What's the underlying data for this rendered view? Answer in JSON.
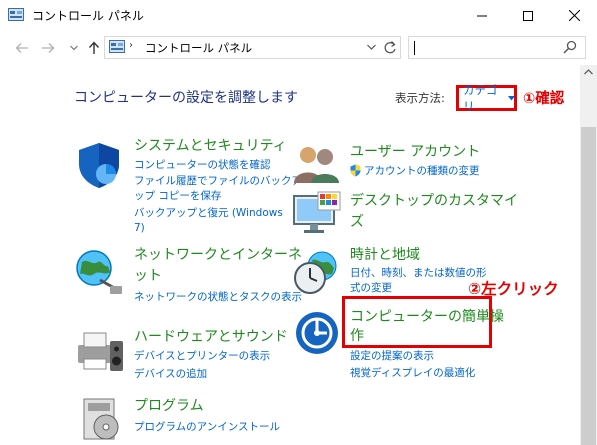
{
  "window": {
    "title": "コントロール パネル"
  },
  "address": {
    "separator": "›",
    "path": "コントロール パネル"
  },
  "content": {
    "heading": "コンピューターの設定を調整します",
    "view_by_label": "表示方法:",
    "view_by_value": "カテゴリ"
  },
  "annotations": {
    "step1": "①確認",
    "step2": "②左クリック"
  },
  "categories": {
    "system": {
      "title": "システムとセキュリティ",
      "links": [
        "コンピューターの状態を確認",
        "ファイル履歴でファイルのバックア",
        "ップ コピーを保存",
        "バックアップと復元 (Windows",
        "7)"
      ]
    },
    "network": {
      "title_line1": "ネットワークとインターネ",
      "title_line2": "ット",
      "links": [
        "ネットワークの状態とタスクの表示"
      ]
    },
    "hardware": {
      "title": "ハードウェアとサウンド",
      "links": [
        "デバイスとプリンターの表示",
        "デバイスの追加"
      ]
    },
    "programs": {
      "title": "プログラム",
      "links": [
        "プログラムのアンインストール"
      ]
    },
    "users": {
      "title": "ユーザー アカウント",
      "links": [
        "アカウントの種類の変更"
      ]
    },
    "appearance": {
      "title_line1": "デスクトップのカスタマイ",
      "title_line2": "ズ"
    },
    "clock": {
      "title": "時計と地域",
      "links": [
        "日付、時刻、または数値の形",
        "式の変更"
      ]
    },
    "ease": {
      "title_line1": "コンピューターの簡単操",
      "title_line2": "作",
      "links": [
        "設定の提案の表示",
        "視覚ディスプレイの最適化"
      ]
    }
  },
  "colors": {
    "accent_red": "#e30000",
    "category_green": "#1e8a1e",
    "link_blue": "#0066cc",
    "heading_blue": "#1e3287"
  }
}
